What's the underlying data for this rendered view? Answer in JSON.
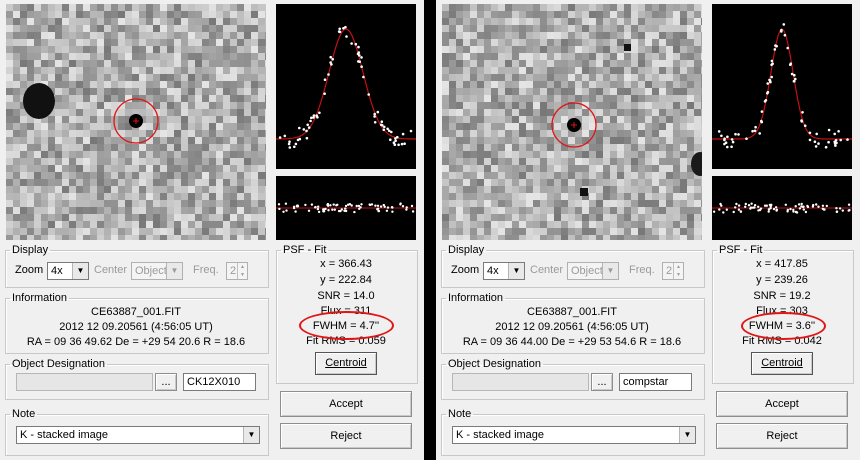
{
  "panels": [
    {
      "display": {
        "legend": "Display",
        "zoom_label": "Zoom",
        "zoom_value": "4x",
        "center_label": "Center",
        "center_value": "Object",
        "freq_label": "Freq.",
        "freq_value": "2"
      },
      "information": {
        "legend": "Information",
        "filename": "CE63887_001.FIT",
        "datetime": "2012 12 09.20561 (4:56:05 UT)",
        "coords": "RA = 09 36 49.62   De = +29 54 20.6   R = 18.6"
      },
      "designation": {
        "legend": "Object Designation",
        "browse_label": "...",
        "value": "CK12X010"
      },
      "note": {
        "legend": "Note",
        "value": "K - stacked image"
      },
      "psf": {
        "legend": "PSF - Fit",
        "x": "x = 366.43",
        "y": "y = 222.84",
        "snr": "SNR = 14.0",
        "flux": "Flux = 311",
        "fwhm": "FWHM = 4.7''",
        "fitrms": "Fit RMS = 0.059",
        "centroid_label": "Centroid"
      },
      "accept_label": "Accept",
      "reject_label": "Reject"
    },
    {
      "display": {
        "legend": "Display",
        "zoom_label": "Zoom",
        "zoom_value": "4x",
        "center_label": "Center",
        "center_value": "Object",
        "freq_label": "Freq.",
        "freq_value": "2"
      },
      "information": {
        "legend": "Information",
        "filename": "CE63887_001.FIT",
        "datetime": "2012 12 09.20561 (4:56:05 UT)",
        "coords": "RA = 09 36 44.00   De = +29 53 54.6   R = 18.6"
      },
      "designation": {
        "legend": "Object Designation",
        "browse_label": "...",
        "value": "compstar"
      },
      "note": {
        "legend": "Note",
        "value": "K - stacked image"
      },
      "psf": {
        "legend": "PSF - Fit",
        "x": "x = 417.85",
        "y": "y = 239.26",
        "snr": "SNR = 19.2",
        "flux": "Flux = 303",
        "fwhm": "FWHM = 3.6''",
        "fitrms": "Fit RMS = 0.042",
        "centroid_label": "Centroid"
      },
      "accept_label": "Accept",
      "reject_label": "Reject"
    }
  ],
  "colors": {
    "highlight": "#e01515",
    "fit_curve": "#c41010",
    "points": "#ffffff"
  }
}
